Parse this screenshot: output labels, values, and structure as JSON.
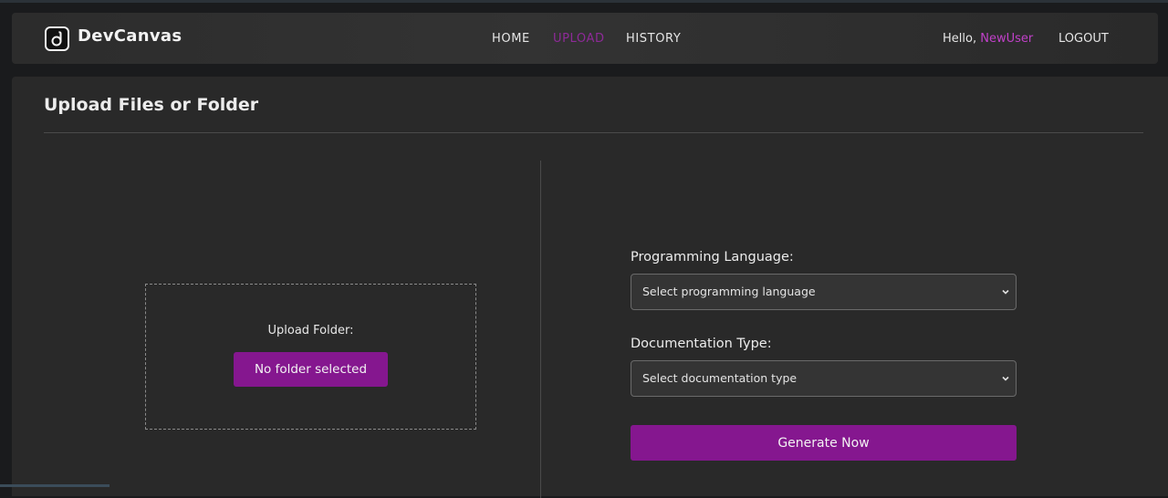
{
  "navbar": {
    "brand": "DevCanvas",
    "links": [
      {
        "label": "HOME",
        "active": false
      },
      {
        "label": "UPLOAD",
        "active": true
      },
      {
        "label": "HISTORY",
        "active": false
      }
    ],
    "greeting": "Hello,",
    "username": "NewUser",
    "logout": "LOGOUT"
  },
  "main": {
    "title": "Upload Files or Folder",
    "upload": {
      "label": "Upload Folder:",
      "button": "No folder selected"
    },
    "form": {
      "language_label": "Programming Language:",
      "language_placeholder": "Select programming language",
      "doc_label": "Documentation Type:",
      "doc_placeholder": "Select documentation type",
      "generate": "Generate Now"
    }
  },
  "colors": {
    "accent": "#85178f",
    "active_link": "#8e2a98",
    "username": "#c040c8",
    "panel": "#292929",
    "background": "#1a1b1d"
  },
  "icons": {
    "logo": "devcanvas-logo-icon",
    "select_arrow": "chevron-down-icon"
  }
}
